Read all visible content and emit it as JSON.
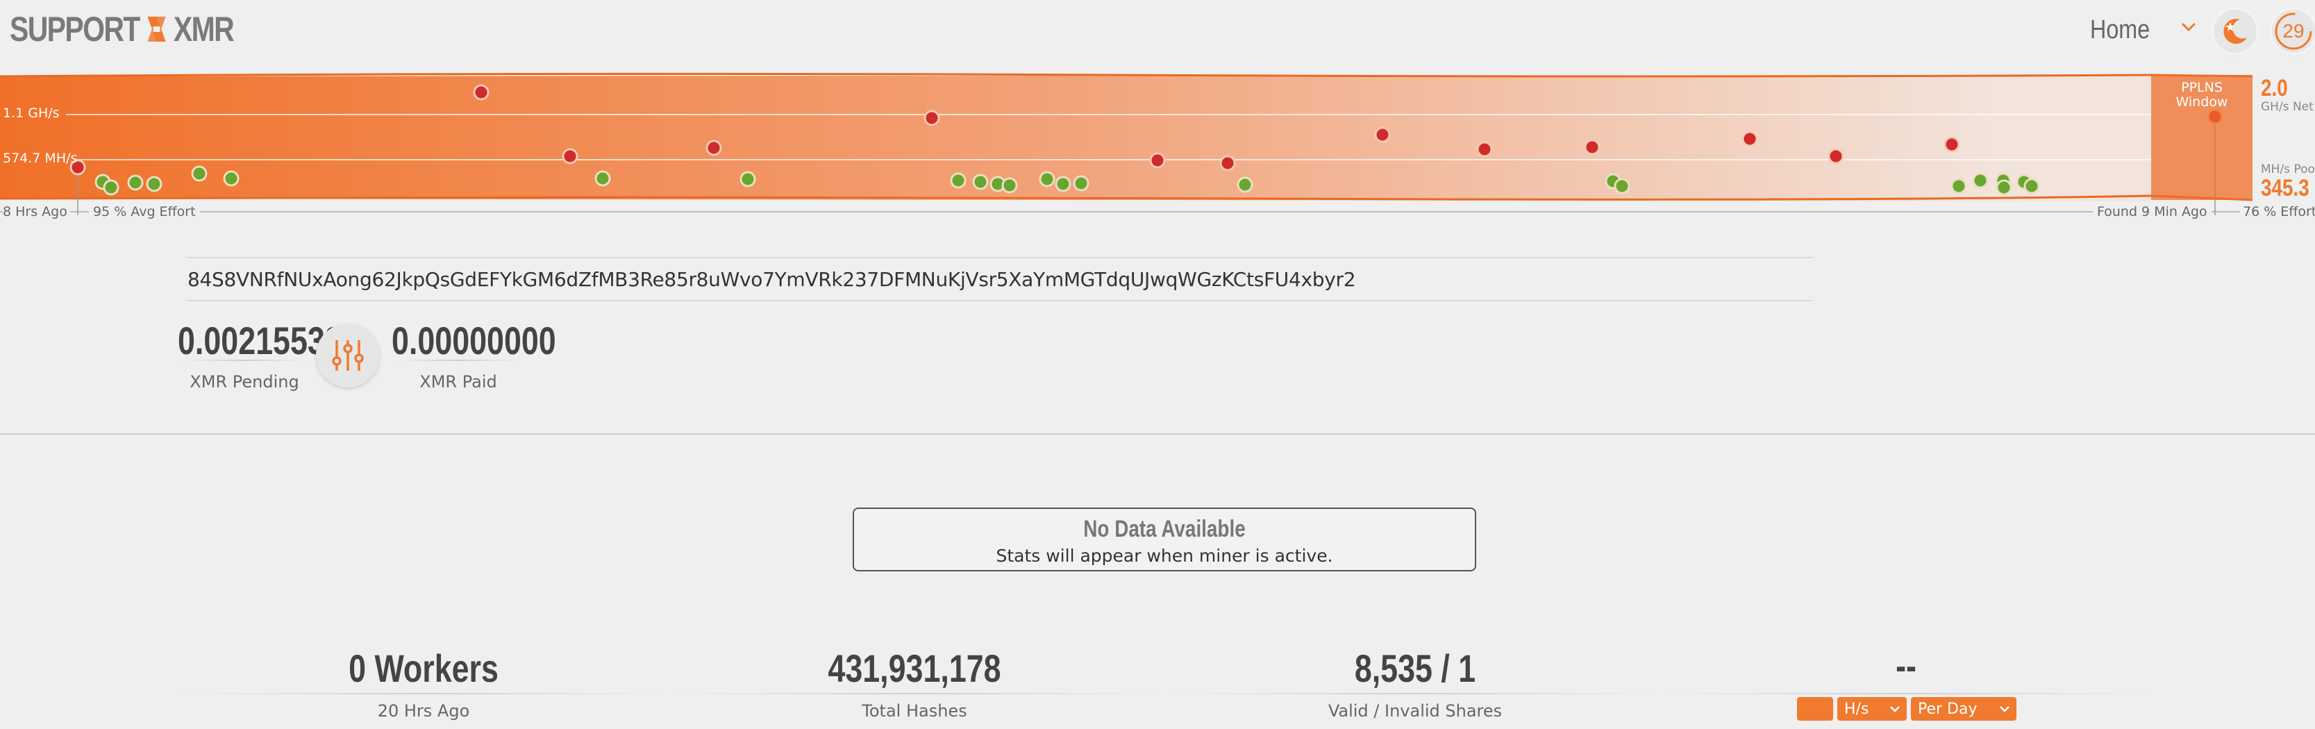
{
  "header": {
    "logo_left": "SUPPORT",
    "logo_right": "XMR",
    "nav_home": "Home",
    "timer_value": "29"
  },
  "chart": {
    "labels": {
      "net_rate": "1.1 GH/s",
      "pool_rate": "574.7 MH/s",
      "left_time": "8 Hrs Ago",
      "avg_effort": "95 % Avg Effort",
      "found": "Found 9 Min Ago",
      "cur_effort": "76 % Effort",
      "pplns_line1": "PPLNS",
      "pplns_line2": "Window",
      "right_net_val": "2.0",
      "right_net_unit": "GH/s Net",
      "right_pool_val": "345.3",
      "right_pool_unit": "MH/s Pool"
    },
    "colors": {
      "accent": "#f07a2e",
      "block_red": "#d02a2a",
      "share_green": "#6aa52f"
    },
    "red_points_count": 17,
    "green_points_count": 29
  },
  "wallet": {
    "address": "84S8VNRfNUxAong62JkpQsGdEFYkGM6dZfMB3Re85r8uWvo7YmVRk237DFMNuKjVsr5XaYmMGTdqUJwqWGzKCtsFU4xbyr2"
  },
  "balances": {
    "pending_value": "0.00215538",
    "pending_label": "XMR Pending",
    "paid_value": "0.00000000",
    "paid_label": "XMR Paid"
  },
  "nodata": {
    "title": "No Data Available",
    "subtitle": "Stats will appear when miner is active."
  },
  "stats": {
    "workers_value": "0 Workers",
    "workers_label": "20 Hrs Ago",
    "hashes_value": "431,931,178",
    "hashes_label": "Total Hashes",
    "shares_value": "8,535 / 1",
    "shares_label": "Valid / Invalid Shares",
    "calc_value": "--",
    "calc_unit": "H/s",
    "calc_period": "Per Day"
  }
}
